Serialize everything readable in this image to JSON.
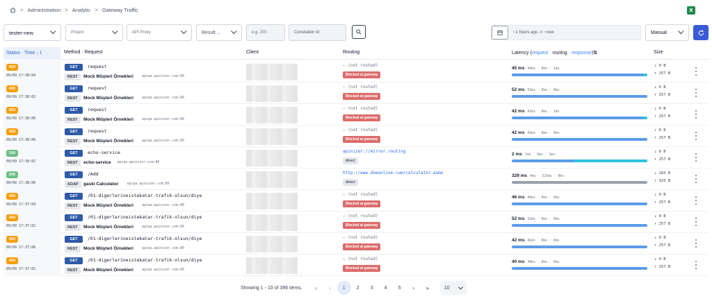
{
  "breadcrumb": {
    "items": [
      "Administration",
      "Analytic",
      "Gateway Traffic"
    ],
    "separator": ">"
  },
  "toolbar": {
    "environment": "tester-new",
    "project_placeholder": "Project",
    "api_proxy_placeholder": "API Proxy",
    "result_placeholder": "Result ...",
    "status_placeholder": "e.g. 200",
    "correlation_placeholder": "Correlation Id",
    "date_range": "~1 hours ago -> ~now",
    "refresh_mode": "Manual"
  },
  "table": {
    "headers": {
      "status_time": "Status · Time",
      "method_request": "Method · Request",
      "client": "Client",
      "routing": "Routing",
      "latency_label": "Latency (",
      "latency_request": "request",
      "latency_routing": "routing",
      "latency_response": "response",
      "latency_close": ")",
      "size": "Size"
    },
    "rows": [
      {
        "status": "403",
        "time": "09/09 17:38:04",
        "method": "GET",
        "protocol": "REST",
        "path": "request",
        "service": "Mock Müşteri Örnekleri",
        "host": "apiqa.apinizer.com:80",
        "route": "— (not routed)",
        "route_badge": "Blocked at gateway",
        "latency": "45 ms",
        "breakdown": "44ms · 0ms · 1ms",
        "down": "↓ 0 B",
        "up": "↑ 257 B"
      },
      {
        "status": "403",
        "time": "09/09 17:38:02",
        "method": "GET",
        "protocol": "REST",
        "path": "request",
        "service": "Mock Müşteri Örnekleri",
        "host": "apiqa.apinizer.com:80",
        "route": "— (not routed)",
        "route_badge": "Blocked at gateway",
        "latency": "52 ms",
        "breakdown": "52ms · 0ms · 0ms",
        "down": "↓ 0 B",
        "up": "↑ 257 B"
      },
      {
        "status": "403",
        "time": "09/09 17:38:00",
        "method": "GET",
        "protocol": "REST",
        "path": "request",
        "service": "Mock Müşteri Örnekleri",
        "host": "apiqa.apinizer.com:80",
        "route": "— (not routed)",
        "route_badge": "Blocked at gateway",
        "latency": "42 ms",
        "breakdown": "41ms · 0ms · 1ms",
        "down": "↓ 0 B",
        "up": "↑ 257 B"
      },
      {
        "status": "403",
        "time": "09/09 17:38:00",
        "method": "GET",
        "protocol": "REST",
        "path": "request",
        "service": "Mock Müşteri Örnekleri",
        "host": "apiqa.apinizer.com:80",
        "route": "— (not routed)",
        "route_badge": "Blocked at gateway",
        "latency": "42 ms",
        "breakdown": "42ms · 0ms · 0ms",
        "down": "↓ 0 B",
        "up": "↑ 257 B"
      },
      {
        "status": "200",
        "time": "09/09 17:38:02",
        "method": "GET",
        "protocol": "REST",
        "path": "echo-service",
        "service": "echo-service",
        "host": "apiqa.apinizer.com:80",
        "route": "apinizer://mirror.routing",
        "route_badge": "direct",
        "latency": "2 ms",
        "breakdown": "1ms · 0ms · 1ms",
        "down": "↓ 0 B",
        "up": "↑ 257 B"
      },
      {
        "status": "200",
        "time": "09/09 17:38:00",
        "method": "GET",
        "protocol": "SOAP",
        "path": "/Add",
        "service": "gaski Calculator",
        "host": "apiqa.apinizer.com:80",
        "route": "http://www.dneonline.com/calculator.asmx",
        "route_badge": "direct",
        "latency": "329 ms",
        "breakdown": "4ms · 325ms · 0ms",
        "down": "↓ 283 B",
        "up": "↑ 325 B"
      },
      {
        "status": "403",
        "time": "09/09 17:37:04",
        "method": "GET",
        "protocol": "REST",
        "path": "/01-digerlerineistekatar-trafik-olsun/diye",
        "service": "Mock Müşteri Örnekleri",
        "host": "apiqa.apinizer.com:80",
        "route": "— (not routed)",
        "route_badge": "Blocked at gateway",
        "latency": "46 ms",
        "breakdown": "46ms · 0ms · 0ms",
        "down": "↓ 0 B",
        "up": "↑ 257 B"
      },
      {
        "status": "403",
        "time": "09/09 17:37:02",
        "method": "GET",
        "protocol": "REST",
        "path": "/01-digerlerineistekatar-trafik-olsun/diye",
        "service": "Mock Müşteri Örnekleri",
        "host": "apiqa.apinizer.com:80",
        "route": "— (not routed)",
        "route_badge": "Blocked at gateway",
        "latency": "52 ms",
        "breakdown": "32ms · 0ms · 0ms",
        "down": "↓ 0 B",
        "up": "↑ 257 B"
      },
      {
        "status": "403",
        "time": "09/09 17:37:00",
        "method": "GET",
        "protocol": "REST",
        "path": "/01-digerlerineistekatar-trafik-olsun/diye",
        "service": "Mock Müşteri Örnekleri",
        "host": "apiqa.apinizer.com:80",
        "route": "— (not routed)",
        "route_badge": "Blocked at gateway",
        "latency": "42 ms",
        "breakdown": "42ms · 0ms · 0ms",
        "down": "↓ 0 B",
        "up": "↑ 257 B"
      },
      {
        "status": "403",
        "time": "09/09 17:37:02",
        "method": "GET",
        "protocol": "REST",
        "path": "/01-digerlerineistekatar-trafik-olsun/diye",
        "service": "Mock Müşteri Örnekleri",
        "host": "apiqa.apinizer.com:80",
        "route": "— (not routed)",
        "route_badge": "Blocked at gateway",
        "latency": "40 ms",
        "breakdown": "40ms · 0ms · 0ms",
        "down": "↓ 0 B",
        "up": "↑ 257 B"
      }
    ]
  },
  "pagination": {
    "info": "Showing 1 - 10 of 396 items.",
    "pages": [
      "1",
      "2",
      "3",
      "4",
      "5"
    ],
    "current": "1",
    "page_size": "10"
  },
  "colors": {
    "accent": "#3a5bd6",
    "status_403": "#f59e0b",
    "status_200": "#6cbf84",
    "method_get": "#2e5aa8",
    "blocked": "#dc6b6b",
    "latency_bar": "#5b9be8",
    "latency_bar_alt": "#9aa1ab",
    "latency_response": "#2fc6dc"
  },
  "icons": [
    "home-icon",
    "excel-export-icon",
    "search-icon",
    "calendar-icon",
    "refresh-icon",
    "sort-icon",
    "kebab-menu-icon"
  ]
}
